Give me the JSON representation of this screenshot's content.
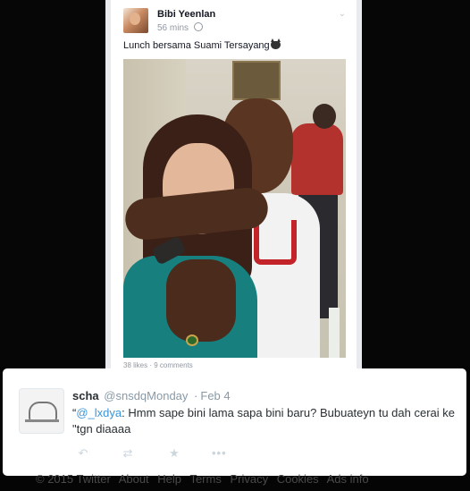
{
  "facebook_post": {
    "author": "Bibi Yeenlan",
    "time": "56 mins",
    "caption": "Lunch bersama Suami Tersayang",
    "stats": "38 likes · 9 comments"
  },
  "tweet": {
    "name": "scha",
    "handle": "@snsdqMonday",
    "separator": "·",
    "time": "Feb 4",
    "quote_open": "“",
    "mention": "@_lxdya",
    "text": ": Hmm sape bini lama sapa bini baru? Bubuateyn tu dah cerai ke \"tgn diaaaa",
    "actions": [
      "reply",
      "retweet",
      "favorite",
      "more"
    ],
    "more_glyph": "•••"
  },
  "footer": {
    "items": [
      "© 2015 Twitter",
      "About",
      "Help",
      "Terms",
      "Privacy",
      "Cookies",
      "Ads info"
    ]
  }
}
